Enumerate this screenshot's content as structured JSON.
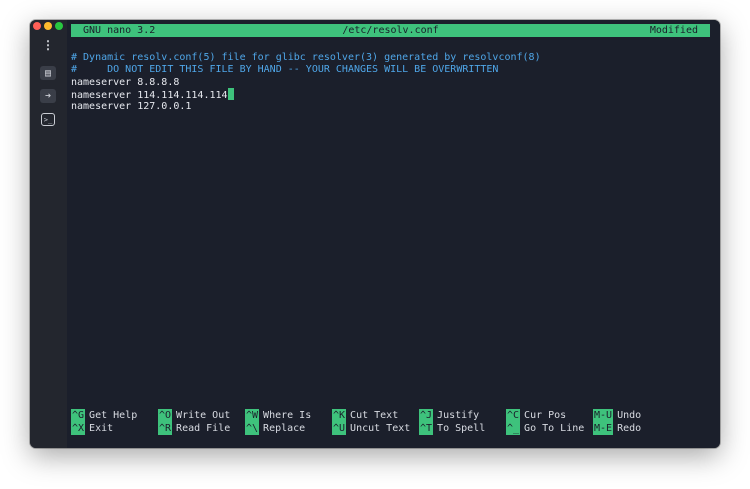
{
  "editor": {
    "app_name": "GNU nano 3.2",
    "file_path": "/etc/resolv.conf",
    "status": "Modified",
    "lines": [
      "# Dynamic resolv.conf(5) file for glibc resolver(3) generated by resolvconf(8)",
      "#     DO NOT EDIT THIS FILE BY HAND -- YOUR CHANGES WILL BE OVERWRITTEN",
      "nameserver 8.8.8.8",
      "nameserver 114.114.114.114",
      "nameserver 127.0.0.1"
    ]
  },
  "shortcuts": {
    "row1": [
      {
        "key": "^G",
        "label": "Get Help"
      },
      {
        "key": "^O",
        "label": "Write Out"
      },
      {
        "key": "^W",
        "label": "Where Is"
      },
      {
        "key": "^K",
        "label": "Cut Text"
      },
      {
        "key": "^J",
        "label": "Justify"
      },
      {
        "key": "^C",
        "label": "Cur Pos"
      },
      {
        "key": "M-U",
        "label": "Undo"
      }
    ],
    "row2": [
      {
        "key": "^X",
        "label": "Exit"
      },
      {
        "key": "^R",
        "label": "Read File"
      },
      {
        "key": "^\\",
        "label": "Replace"
      },
      {
        "key": "^U",
        "label": "Uncut Text"
      },
      {
        "key": "^T",
        "label": "To Spell"
      },
      {
        "key": "^_",
        "label": "Go To Line"
      },
      {
        "key": "M-E",
        "label": "Redo"
      }
    ]
  },
  "sidebar": {
    "icons": [
      "more-vertical-icon",
      "document-icon",
      "arrow-right-icon",
      "terminal-icon"
    ]
  },
  "colors": {
    "accent": "#3ec27c",
    "comment": "#4fa6e8",
    "background": "#1b1f2b"
  }
}
